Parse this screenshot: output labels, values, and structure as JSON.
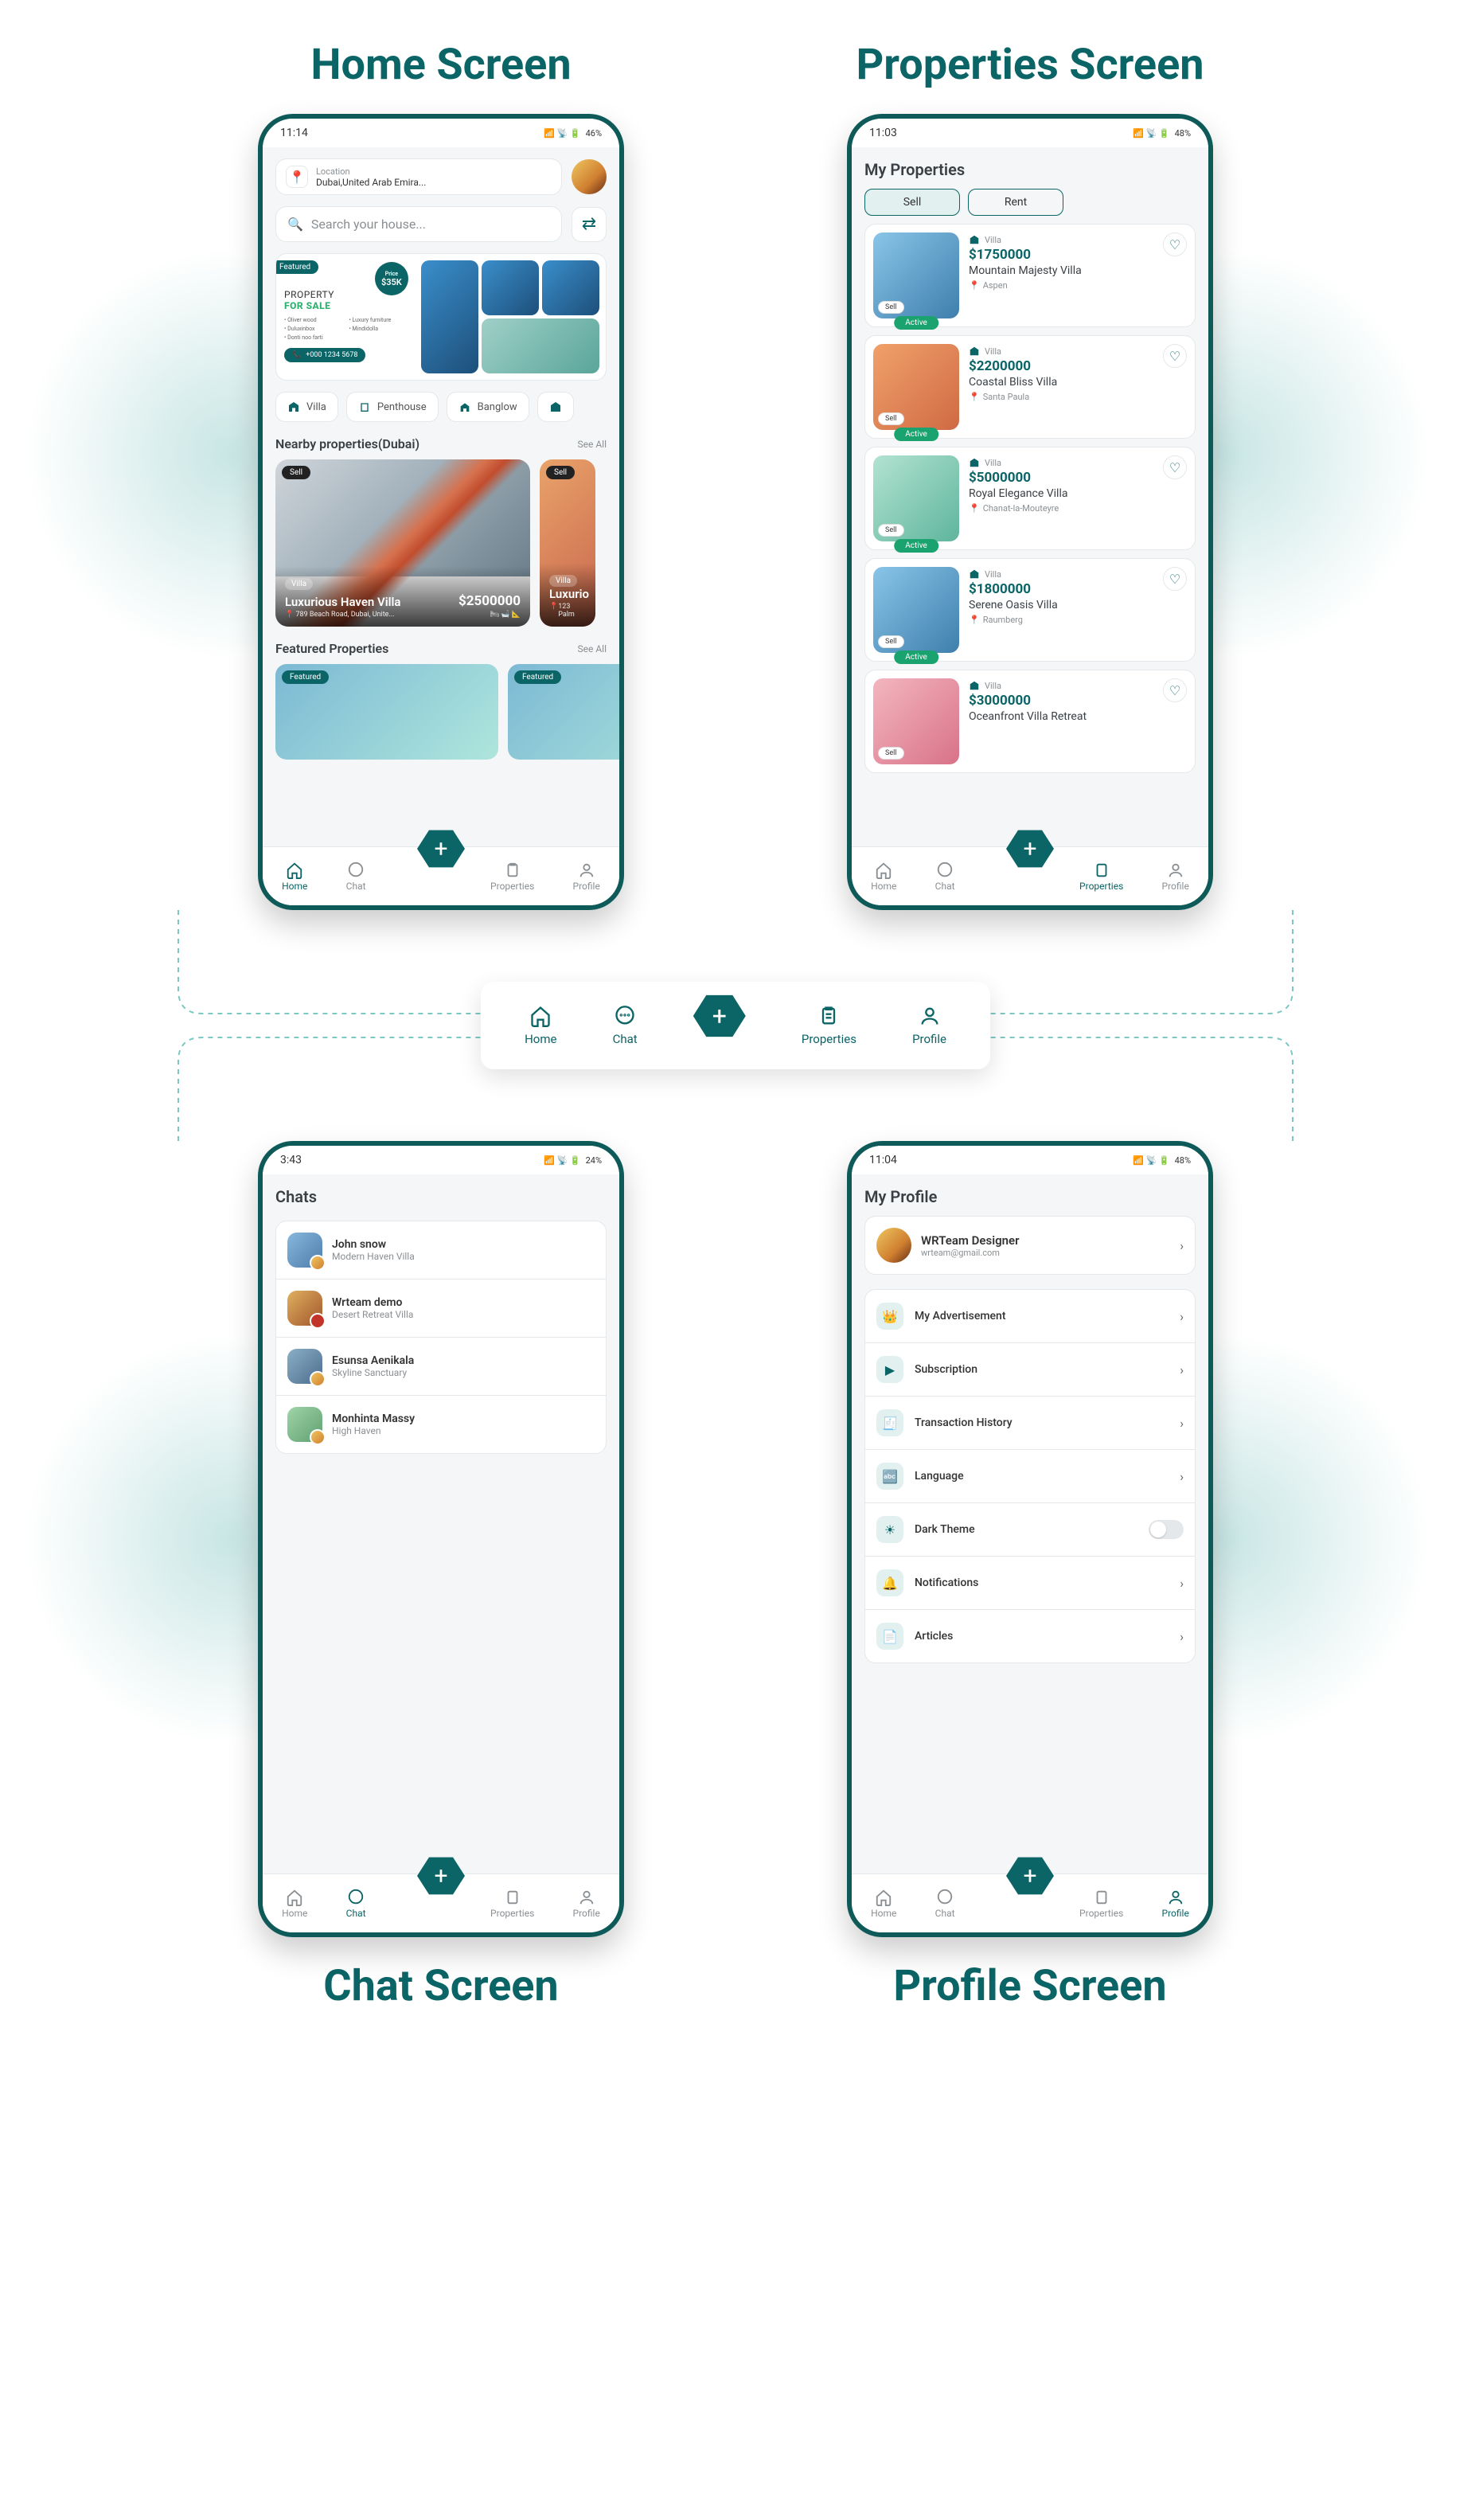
{
  "labels": {
    "home": "Home Screen",
    "properties": "Properties Screen",
    "chat": "Chat Screen",
    "profile": "Profile Screen"
  },
  "dock": {
    "home": "Home",
    "chat": "Chat",
    "properties": "Properties",
    "profile": "Profile"
  },
  "nav": {
    "home": "Home",
    "chat": "Chat",
    "properties": "Properties",
    "profile": "Profile"
  },
  "status": {
    "home": "11:14",
    "prop": "11:03",
    "chat": "3:43",
    "profile": "11:04",
    "bat_home": "46%",
    "bat_prop": "48%",
    "bat_chat": "24%",
    "bat_profile": "48%"
  },
  "home": {
    "loc_label": "Location",
    "loc_val": "Dubai,United Arab Emira...",
    "search_ph": "Search your house...",
    "banner": {
      "featured": "Featured",
      "price_small": "Price",
      "price": "$35K",
      "title1": "PROPERTY",
      "title2": "FOR SALE",
      "phone": "+000 1234 5678",
      "bullets": [
        "Oliver wood",
        "Duluxinbox",
        "Donti noo farti",
        "Luxury furniture",
        "Mindidolla"
      ]
    },
    "chips": [
      "Villa",
      "Penthouse",
      "Banglow"
    ],
    "nearby_title": "Nearby properties(Dubai)",
    "see_all": "See All",
    "card": {
      "tag": "Sell",
      "cat": "Villa",
      "name": "Luxurious Haven Villa",
      "price": "$2500000",
      "addr": "789 Beach Road, Dubai, Unite..."
    },
    "card2": {
      "tag": "Sell",
      "cat": "Villa",
      "name": "Luxurio",
      "addr": "123 Palm"
    },
    "featured_title": "Featured Properties",
    "featured_badge": "Featured"
  },
  "properties": {
    "title": "My Properties",
    "sell": "Sell",
    "rent": "Rent",
    "active": "Active",
    "items": [
      {
        "cat": "Villa",
        "price": "$1750000",
        "name": "Mountain Majesty Villa",
        "loc": "Aspen",
        "tag": "Sell"
      },
      {
        "cat": "Villa",
        "price": "$2200000",
        "name": "Coastal Bliss Villa",
        "loc": "Santa Paula",
        "tag": "Sell"
      },
      {
        "cat": "Villa",
        "price": "$5000000",
        "name": "Royal Elegance Villa",
        "loc": "Chanat-la-Mouteyre",
        "tag": "Sell"
      },
      {
        "cat": "Villa",
        "price": "$1800000",
        "name": "Serene Oasis Villa",
        "loc": "Raumberg",
        "tag": "Sell"
      },
      {
        "cat": "Villa",
        "price": "$3000000",
        "name": "Oceanfront Villa Retreat",
        "loc": "",
        "tag": "Sell"
      }
    ]
  },
  "chats": {
    "title": "Chats",
    "items": [
      {
        "name": "John snow",
        "sub": "Modern Haven Villa"
      },
      {
        "name": "Wrteam demo",
        "sub": "Desert Retreat Villa"
      },
      {
        "name": "Esunsa Aenikala",
        "sub": "Skyline Sanctuary"
      },
      {
        "name": "Monhinta Massy",
        "sub": "High Haven"
      }
    ]
  },
  "profile": {
    "title": "My Profile",
    "name": "WRTeam Designer",
    "email": "wrteam@gmail.com",
    "items": [
      "My Advertisement",
      "Subscription",
      "Transaction History",
      "Language",
      "Dark Theme",
      "Notifications",
      "Articles"
    ]
  }
}
